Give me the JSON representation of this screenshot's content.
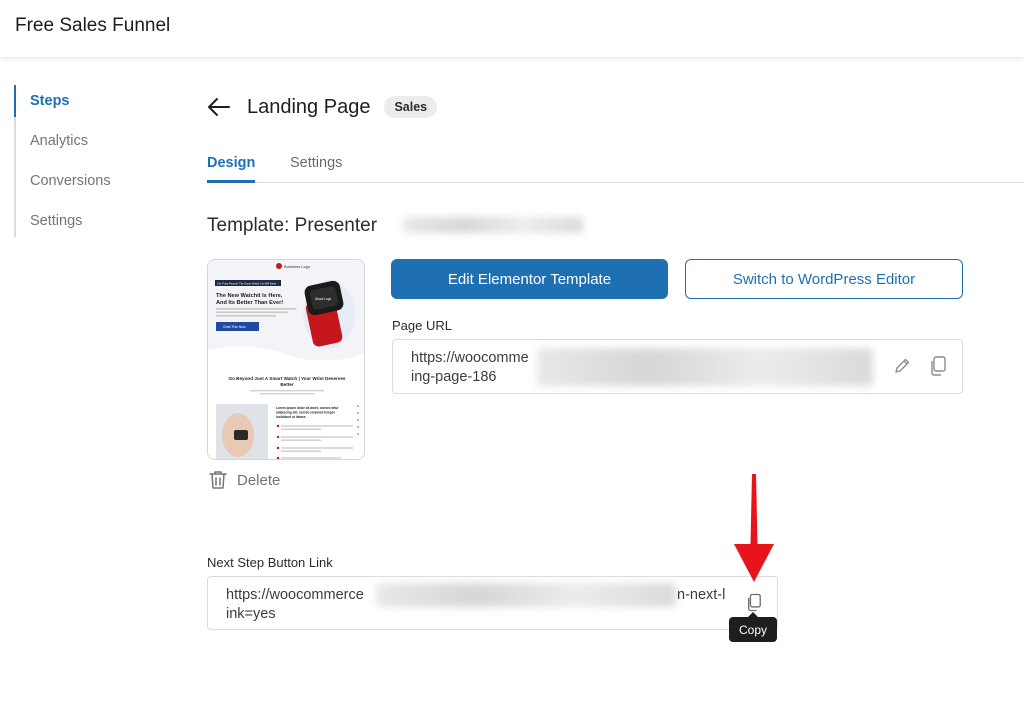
{
  "app": {
    "title": "Free Sales Funnel"
  },
  "sidebar": {
    "items": [
      {
        "label": "Steps",
        "active": true
      },
      {
        "label": "Analytics",
        "active": false
      },
      {
        "label": "Conversions",
        "active": false
      },
      {
        "label": "Settings",
        "active": false
      }
    ]
  },
  "header": {
    "title": "Landing Page",
    "badge": "Sales",
    "back_icon": "arrow-left-icon"
  },
  "tabs": [
    {
      "label": "Design",
      "active": true
    },
    {
      "label": "Settings",
      "active": false
    }
  ],
  "template": {
    "title": "Template: Presenter",
    "delete_label": "Delete",
    "preview": {
      "logo": "Business Logo",
      "promo_banner": "Get 'Forty Percent' The Smart Watch You Will Need",
      "headline": "The New Watchit Is Here, And Its Better Than Ever!",
      "cta": "Grab This Now",
      "watch_label": "About Logo",
      "section_title": "Go Beyond Just A Smart Watch | Your Wrist Deserves Better",
      "body_text": "Lorem ipsum dolor sit amet, consec tetur adipiscing elit, sed do eiusmod tempor incididunt ut labore."
    }
  },
  "buttons": {
    "edit_template": "Edit Elementor Template",
    "switch_editor": "Switch to WordPress Editor"
  },
  "page_url": {
    "label": "Page URL",
    "line1": "https://woocomme",
    "line2": "ing-page-186"
  },
  "next_step": {
    "label": "Next Step Button Link",
    "line1_start": "https://woocommerce",
    "line1_end": "n-next-l",
    "line2": "ink=yes"
  },
  "tooltip": {
    "text": "Copy"
  },
  "colors": {
    "accent": "#1f6fb3",
    "annotation_arrow": "#e8141b",
    "tooltip_bg": "#1e1e1e"
  }
}
